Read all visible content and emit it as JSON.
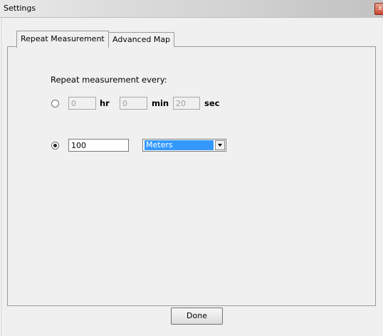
{
  "window": {
    "title": "Settings",
    "close_glyph": "x"
  },
  "tabs": [
    {
      "label": "Repeat Measurement",
      "selected": true
    },
    {
      "label": "Advanced Map",
      "selected": false
    }
  ],
  "repeat": {
    "label": "Repeat measurement every:",
    "time_option": {
      "selected": false,
      "hr_value": "0",
      "hr_unit": "hr",
      "min_value": "0",
      "min_unit": "min",
      "sec_value": "20",
      "sec_unit": "sec"
    },
    "distance_option": {
      "selected": true,
      "value": "100",
      "unit_selected": "Meters"
    }
  },
  "footer": {
    "done_label": "Done"
  },
  "icons": {
    "close": "close-icon",
    "dropdown": "chevron-down-icon"
  },
  "colors": {
    "selection": "#3399ff",
    "close_button": "#c9452b"
  }
}
